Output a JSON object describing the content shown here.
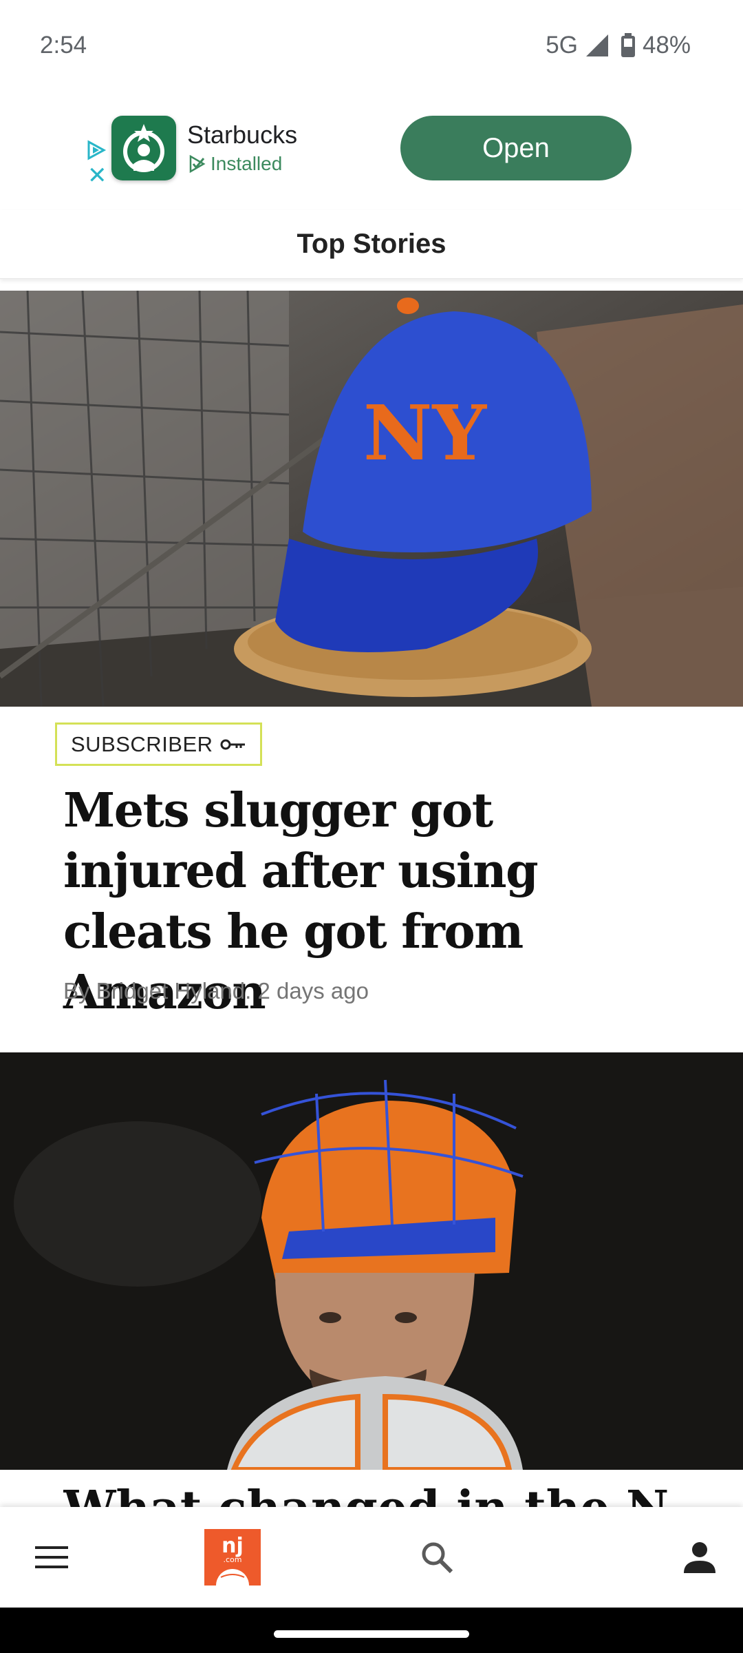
{
  "status_bar": {
    "time": "2:54",
    "network": "5G",
    "battery": "48%"
  },
  "ad": {
    "app_name": "Starbucks",
    "installed_label": "Installed",
    "open_label": "Open",
    "close_glyph": "✕",
    "accent_color": "#3a7d5c"
  },
  "section": {
    "title": "Top Stories"
  },
  "stories": [
    {
      "badge": "SUBSCRIBER",
      "headline": "Mets slugger got injured after using cleats he got from Amazon",
      "byline": "By Bridget Hyland. 2 days ago",
      "image": "mets-cap-on-glove-photo"
    },
    {
      "headline_partial": "What changed in the N",
      "image": "mets-catcher-photo"
    }
  ],
  "nav": {
    "items": [
      "menu-icon",
      "nj-logo",
      "search-icon",
      "account-icon"
    ],
    "logo_text": "nj",
    "logo_sub": ".com"
  }
}
